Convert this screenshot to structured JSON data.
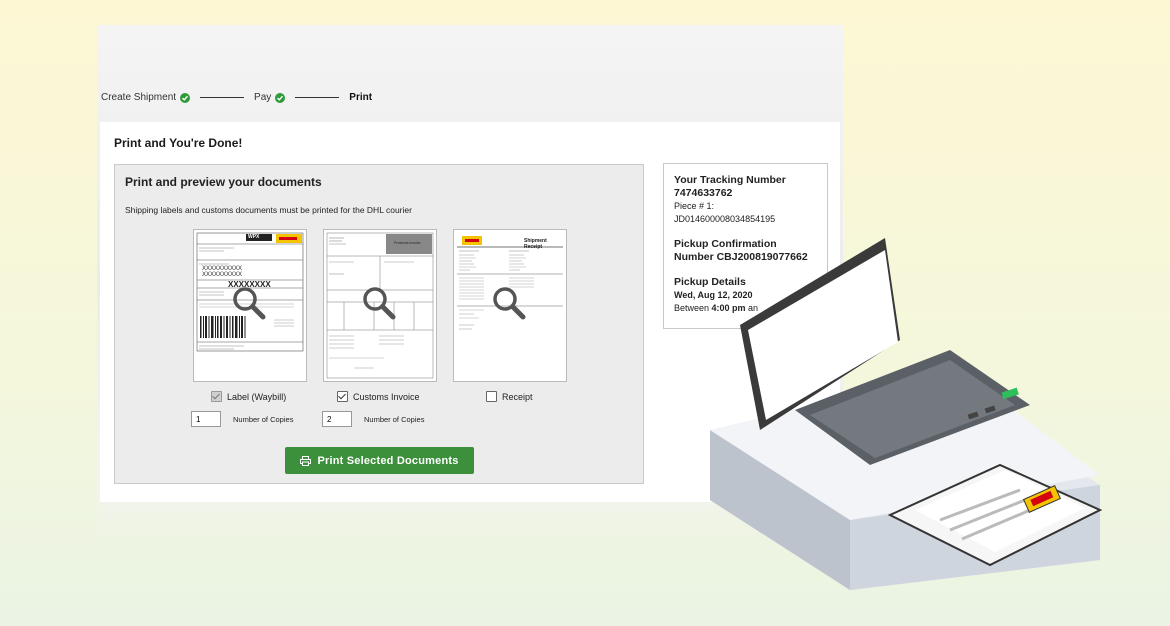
{
  "stepper": {
    "steps": [
      {
        "label": "Create Shipment",
        "state": "done"
      },
      {
        "label": "Pay",
        "state": "done"
      },
      {
        "label": "Print",
        "state": "current"
      }
    ]
  },
  "page": {
    "title": "Print and You're Done!"
  },
  "documents": {
    "title": "Print and preview your documents",
    "subtitle": "Shipping labels and customs documents must be printed for the DHL courier",
    "items": [
      {
        "label": "Label (Waybill)",
        "checked": true,
        "disabled": true,
        "copies": "1"
      },
      {
        "label": "Customs Invoice",
        "checked": true,
        "disabled": false,
        "copies": "2"
      },
      {
        "label": "Receipt",
        "checked": false,
        "disabled": false
      }
    ],
    "copies_label": "Number of Copies",
    "thumb_texts": {
      "waybill_code": "WPX",
      "xxx_short": "XXXXXXXXXX",
      "xxx_long": "XXXXXXXX",
      "receipt_title": "Shipment Receipt",
      "invoice_title": "Proforma Invoice"
    }
  },
  "print_button": {
    "label": "Print Selected Documents"
  },
  "tracking": {
    "heading": "Your Tracking Number",
    "number": "7474633762",
    "piece_label": "Piece # 1:",
    "piece_id": "JD014600008034854195",
    "pickup_conf_heading": "Pickup Confirmation",
    "pickup_conf_number": "Number CBJ200819077662",
    "pickup_details_heading": "Pickup Details",
    "pickup_date": "Wed, Aug 12, 2020",
    "pickup_time_prefix": "Between ",
    "pickup_time": "4:00 pm",
    "pickup_time_suffix": " an"
  },
  "colors": {
    "accent_green": "#3c8f3b",
    "check_green": "#2f9a3a",
    "dhl_yellow": "#f5c400",
    "dhl_red": "#d40511"
  }
}
